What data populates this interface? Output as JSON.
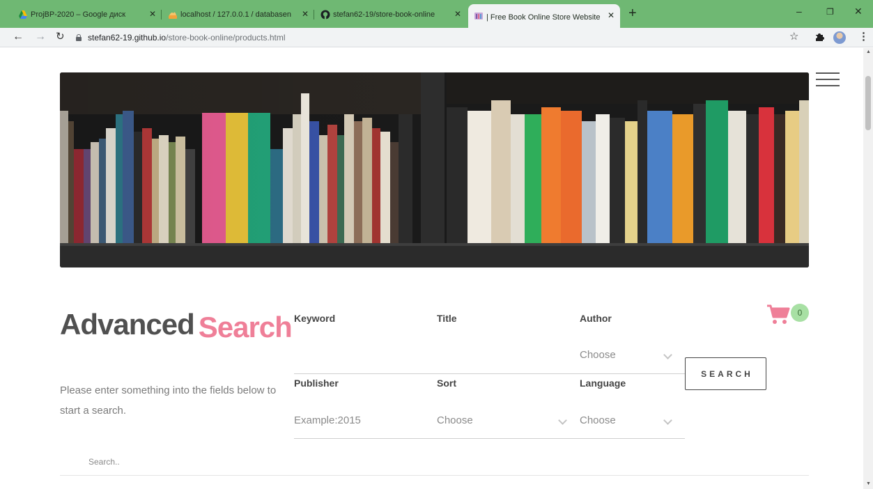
{
  "browser": {
    "tabs": [
      {
        "title": "ProjBP-2020 – Google диск",
        "favicon": "google-drive-icon"
      },
      {
        "title": "localhost / 127.0.0.1 / databasen",
        "favicon": "phpmyadmin-icon"
      },
      {
        "title": "stefan62-19/store-book-online",
        "favicon": "github-icon"
      },
      {
        "title": "| Free Book Online Store Website",
        "favicon": "bookstore-icon",
        "active": true
      }
    ],
    "url_host": "stefan62-19.github.io",
    "url_path": "/store-book-online/products.html"
  },
  "page": {
    "title_dark": "Advanced",
    "title_accent": "Search",
    "intro": "Please enter something into the fields below to start a search.",
    "fields": {
      "keyword": {
        "label": "Keyword",
        "value": ""
      },
      "title": {
        "label": "Title",
        "value": ""
      },
      "author": {
        "label": "Author",
        "value": "Choose"
      },
      "publisher": {
        "label": "Publisher",
        "placeholder": "Example:2015"
      },
      "sort": {
        "label": "Sort",
        "value": "Choose"
      },
      "language": {
        "label": "Language",
        "value": "Choose"
      }
    },
    "search_button": "SEARCH",
    "cart_count": "0",
    "search_placeholder": "Search.."
  },
  "colors": {
    "accent": "#ef7f98",
    "cart_badge": "#a8e0a4",
    "tabbar": "#6fb873"
  }
}
